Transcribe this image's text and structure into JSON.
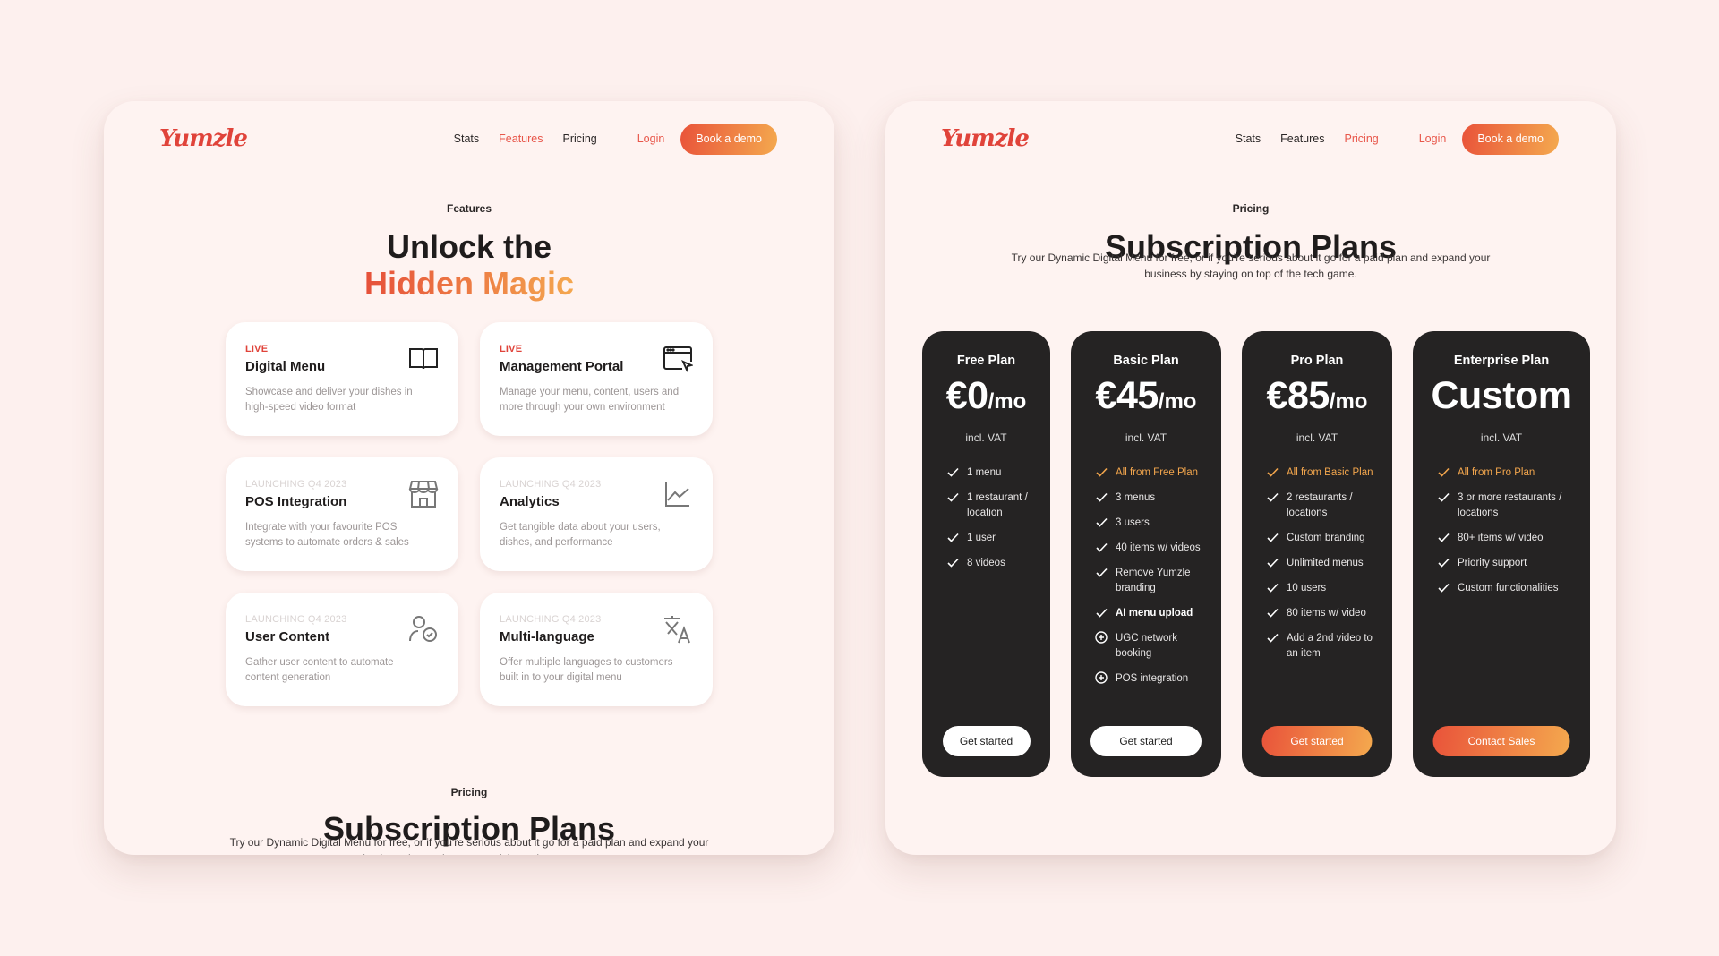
{
  "brand": {
    "logo": "Yumzle",
    "accent": "#E8564A",
    "gradient_start": "#E9533A",
    "gradient_end": "#F4A94E"
  },
  "left": {
    "nav": {
      "links": [
        "Stats",
        "Features",
        "Pricing"
      ],
      "active": "Features",
      "login": "Login",
      "cta": "Book a demo"
    },
    "eyebrow": "Features",
    "title_line1": "Unlock the",
    "title_line2": "Hidden Magic",
    "features": [
      {
        "status": "LIVE",
        "title": "Digital Menu",
        "desc": "Showcase and deliver your dishes in high-speed video format",
        "icon": "book-open-icon"
      },
      {
        "status": "LIVE",
        "title": "Management Portal",
        "desc": "Manage your menu, content, users and more through your own environment",
        "icon": "browser-cursor-icon"
      },
      {
        "status": "LAUNCHING Q4 2023",
        "title": "POS Integration",
        "desc": "Integrate with your favourite POS systems to automate orders & sales",
        "icon": "storefront-icon"
      },
      {
        "status": "LAUNCHING Q4 2023",
        "title": "Analytics",
        "desc": "Get tangible data about your users, dishes, and performance",
        "icon": "line-chart-icon"
      },
      {
        "status": "LAUNCHING Q4 2023",
        "title": "User Content",
        "desc": "Gather user content to automate content generation",
        "icon": "user-check-icon"
      },
      {
        "status": "LAUNCHING Q4 2023",
        "title": "Multi-language",
        "desc": "Offer multiple languages to customers built in to your digital menu",
        "icon": "translate-icon"
      }
    ],
    "pricing_eyebrow": "Pricing",
    "pricing_title": "Subscription Plans",
    "pricing_sub": "Try our Dynamic Digital Menu for free, or if you're serious about it go for a paid plan and expand your business by staying on top of the tech game."
  },
  "right": {
    "nav": {
      "links": [
        "Stats",
        "Features",
        "Pricing"
      ],
      "active": "Pricing",
      "login": "Login",
      "cta": "Book a demo"
    },
    "eyebrow": "Pricing",
    "title": "Subscription Plans",
    "sub_line1": "Try our Dynamic Digital Menu for free, or if you're serious about it go for a paid plan and expand your",
    "sub_line2": "business by staying on top of the tech game.",
    "plans": [
      {
        "name": "Free Plan",
        "price": "€0",
        "unit": "/mo",
        "vat": "incl. VAT",
        "button": "Get started",
        "button_style": "white",
        "features": [
          {
            "text": "1 menu",
            "icon": "check"
          },
          {
            "text": "1 restaurant / location",
            "icon": "check"
          },
          {
            "text": "1 user",
            "icon": "check"
          },
          {
            "text": "8 videos",
            "icon": "check"
          }
        ]
      },
      {
        "name": "Basic Plan",
        "price": "€45",
        "unit": "/mo",
        "vat": "incl. VAT",
        "button": "Get started",
        "button_style": "white",
        "features": [
          {
            "text": "All from Free Plan",
            "icon": "check",
            "highlight": true
          },
          {
            "text": "3 menus",
            "icon": "check"
          },
          {
            "text": "3 users",
            "icon": "check"
          },
          {
            "text": "40 items w/ videos",
            "icon": "check"
          },
          {
            "text": "Remove Yumzle branding",
            "icon": "check"
          },
          {
            "text": "AI menu upload",
            "icon": "check",
            "bold": true
          },
          {
            "text": "UGC network booking",
            "icon": "plus-circle"
          },
          {
            "text": "POS integration",
            "icon": "plus-circle"
          }
        ]
      },
      {
        "name": "Pro Plan",
        "price": "€85",
        "unit": "/mo",
        "vat": "incl. VAT",
        "button": "Get started",
        "button_style": "orange",
        "features": [
          {
            "text": "All from Basic Plan",
            "icon": "check",
            "highlight": true
          },
          {
            "text": "2 restaurants / locations",
            "icon": "check"
          },
          {
            "text": "Custom branding",
            "icon": "check"
          },
          {
            "text": "Unlimited menus",
            "icon": "check"
          },
          {
            "text": "10 users",
            "icon": "check"
          },
          {
            "text": "80 items w/ video",
            "icon": "check"
          },
          {
            "text": "Add a 2nd video to an item",
            "icon": "check"
          }
        ]
      },
      {
        "name": "Enterprise Plan",
        "price": "Custom",
        "unit": "",
        "vat": "incl. VAT",
        "button": "Contact Sales",
        "button_style": "orange",
        "features": [
          {
            "text": "All from Pro Plan",
            "icon": "check",
            "highlight": true
          },
          {
            "text": "3 or more restaurants / locations",
            "icon": "check"
          },
          {
            "text": "80+ items w/ video",
            "icon": "check"
          },
          {
            "text": "Priority support",
            "icon": "check"
          },
          {
            "text": "Custom functionalities",
            "icon": "check"
          }
        ]
      }
    ]
  }
}
